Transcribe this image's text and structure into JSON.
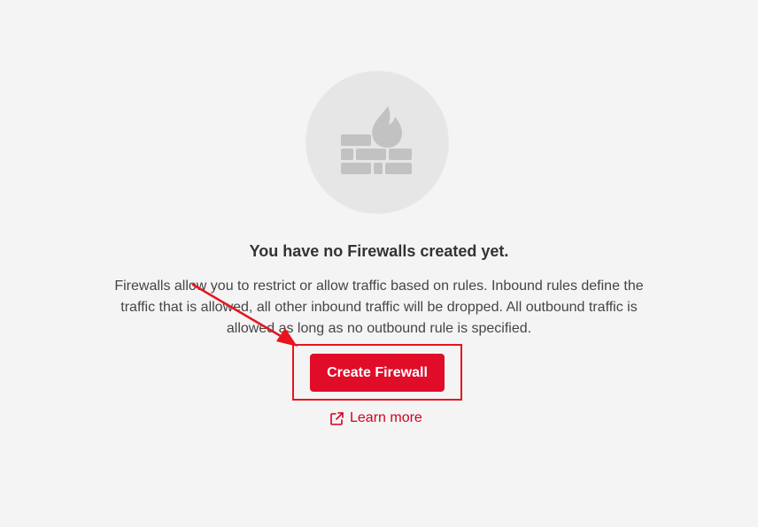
{
  "empty_state": {
    "icon": "firewall-icon",
    "title": "You have no Firewalls created yet.",
    "description": "Firewalls allow you to restrict or allow traffic based on rules. Inbound rules define the traffic that is allowed, all other inbound traffic will be dropped. All outbound traffic is allowed as long as no outbound rule is specified.",
    "primary_button_label": "Create Firewall",
    "learn_more_label": "Learn more",
    "learn_more_icon": "external-link-icon"
  },
  "annotation": {
    "type": "arrow-and-highlight",
    "color": "#e8141f"
  },
  "colors": {
    "background": "#f4f4f4",
    "brand": "#e00c28",
    "link": "#d6001c",
    "icon_circle": "#e6e6e6",
    "icon_glyph": "#c0c0c0"
  }
}
